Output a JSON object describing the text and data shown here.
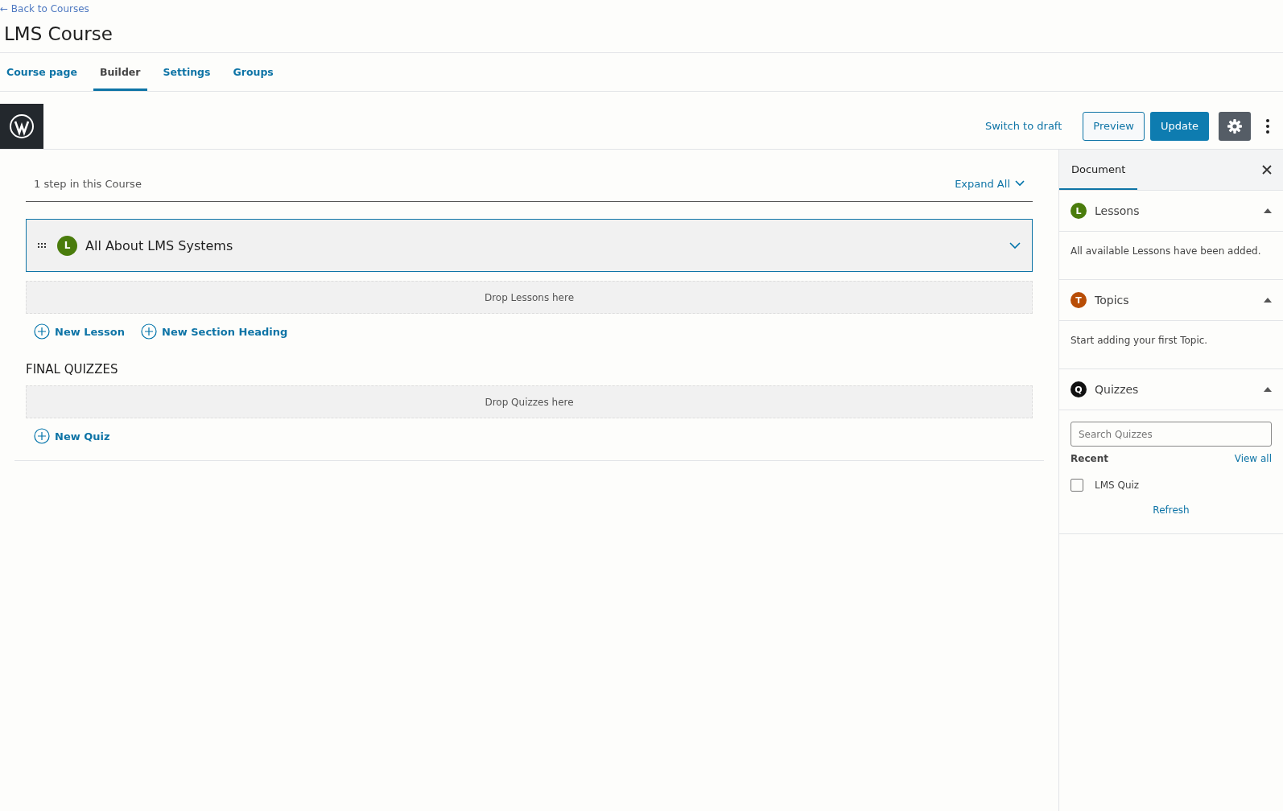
{
  "back_link": "← Back to Courses",
  "title": "LMS Course",
  "tabs": [
    {
      "label": "Course page",
      "selected": false
    },
    {
      "label": "Builder",
      "selected": true
    },
    {
      "label": "Settings",
      "selected": false
    },
    {
      "label": "Groups",
      "selected": false
    }
  ],
  "toolbar": {
    "switch_to_draft": "Switch to draft",
    "preview": "Preview",
    "update": "Update"
  },
  "builder": {
    "step_count": "1 step in this Course",
    "expand_all": "Expand All",
    "lessons": [
      {
        "badge": "L",
        "color": "#4a7c0c",
        "title": "All About LMS Systems"
      }
    ],
    "drop_lessons": "Drop Lessons here",
    "actions": [
      "New Lesson",
      "New Section Heading"
    ],
    "final_quizzes_heading": "FINAL QUIZZES",
    "drop_quizzes": "Drop Quizzes here",
    "quiz_action": "New Quiz"
  },
  "sidebar": {
    "tab": "Document",
    "panels": [
      {
        "kind": "message",
        "badge": "L",
        "color": "#4a7c0c",
        "title": "Lessons",
        "expanded": true,
        "message": "All available Lessons have been added."
      },
      {
        "kind": "message",
        "badge": "T",
        "color": "#b84d06",
        "title": "Topics",
        "expanded": true,
        "message": "Start adding your first Topic."
      },
      {
        "kind": "search",
        "badge": "Q",
        "color": "#111111",
        "title": "Quizzes",
        "expanded": true,
        "placeholder": "Search Quizzes",
        "recent": "Recent",
        "view_all": "View all",
        "items": [
          {
            "label": "LMS Quiz",
            "checked": false
          }
        ],
        "refresh": "Refresh"
      }
    ]
  }
}
